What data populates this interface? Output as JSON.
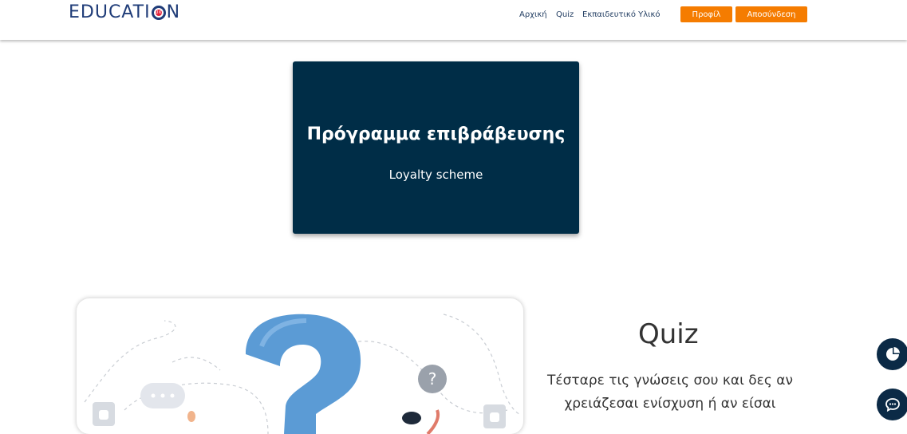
{
  "header": {
    "logo_text": "EDUCATI",
    "logo_suffix": "N",
    "nav": [
      "Αρχική",
      "Quiz",
      "Εκπαιδευτικό Υλικό"
    ],
    "profile_label": "Προφίλ",
    "logout_label": "Αποσύνδεση"
  },
  "banner": {
    "title": "Πρόγραμμα επιβράβευσης",
    "subtitle": "Loyalty scheme"
  },
  "quiz": {
    "title": "Quiz",
    "description_line1": "Τέσταρε τις γνώσεις σου και δες αν",
    "description_line2": "χρειάζεσαι ενίσχυση ή αν είσαι"
  },
  "colors": {
    "brand_dark": "#002d47",
    "accent_orange": "#f57c00",
    "logo_blue": "#1f3c78",
    "question_blue": "#5b9bd5"
  },
  "icons": {
    "float_top": "pie-chart-icon",
    "float_bottom": "chat-icon"
  }
}
